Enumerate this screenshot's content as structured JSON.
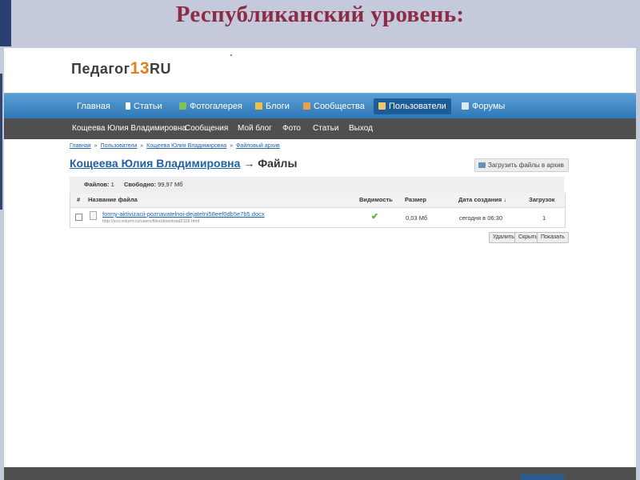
{
  "slide": {
    "title": "Республиканский уровень:"
  },
  "site": {
    "logo_text": "Педагог",
    "logo_number": "13",
    "logo_suffix": "RU"
  },
  "nav": {
    "items": [
      {
        "label": "Главная",
        "icon": ""
      },
      {
        "label": "Статьи",
        "icon": "article-icon"
      },
      {
        "label": "Фотогалерея",
        "icon": "photo-gallery-icon"
      },
      {
        "label": "Блоги",
        "icon": "blog-icon"
      },
      {
        "label": "Сообщества",
        "icon": "communities-icon"
      },
      {
        "label": "Пользователи",
        "icon": "users-icon",
        "active": true
      },
      {
        "label": "Форумы",
        "icon": "forums-icon"
      }
    ]
  },
  "subnav": {
    "items": [
      {
        "label": "Кощеева Юлия Владимировна"
      },
      {
        "label": "Сообщения"
      },
      {
        "label": "Мой блог"
      },
      {
        "label": "Фото"
      },
      {
        "label": "Статьи"
      },
      {
        "label": "Выход"
      }
    ]
  },
  "breadcrumb": {
    "items": [
      "Главная",
      "Пользователи",
      "Кощеева Юлия Владимировна",
      "Файловый архив"
    ],
    "separator": "»"
  },
  "page": {
    "user_name": "Кощеева Юлия Владимировна",
    "arrow": "→",
    "title_suffix": "Файлы",
    "upload_label": "Загрузить файлы в архив"
  },
  "stats": {
    "files_label": "Файлов:",
    "files_value": "1",
    "free_label": "Свободно:",
    "free_value": "99,97 Мб"
  },
  "table": {
    "headers": {
      "num": "#",
      "name": "Название файла",
      "visibility": "Видимость",
      "size": "Размер",
      "created": "Дата создания ↓",
      "downloads": "Загрузок"
    },
    "rows": [
      {
        "file_name": "formy-aktivizacii-poznavatelnoi-dejatelni58eef0db5e7b5.docx",
        "file_url": "http://soo.edurm.ru/users/files/download2118.html",
        "size": "0,03 Мб",
        "created": "сегодня в 06:30",
        "downloads": "1"
      }
    ]
  },
  "actions": {
    "delete": "Удалить",
    "hide": "Скрыть",
    "show": "Показать"
  },
  "colors": {
    "slide_title": "#8c2b43",
    "nav_bar": "#2f76b6",
    "subnav_bar": "#4f4f4f",
    "link": "#1f5fa6",
    "logo_accent": "#e07f1b",
    "check": "#5fb336"
  }
}
